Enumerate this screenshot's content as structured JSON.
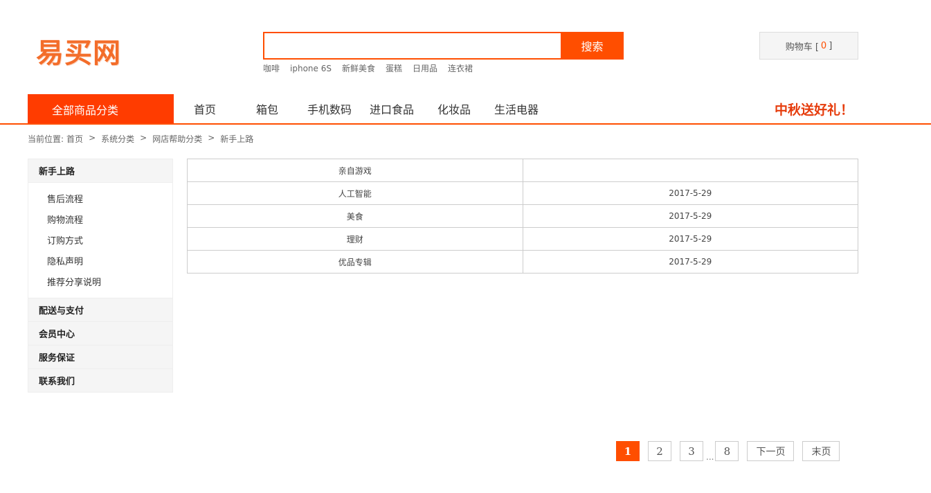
{
  "logo": {
    "text": "易买网"
  },
  "search": {
    "value": "",
    "placeholder": "",
    "button_label": "搜索"
  },
  "hot_words": [
    "咖啡",
    "iphone 6S",
    "新鲜美食",
    "蛋糕",
    "日用品",
    "连衣裙"
  ],
  "cart": {
    "label": "购物车 [",
    "count": "0",
    "suffix": "]"
  },
  "nav": {
    "all_categories": "全部商品分类",
    "items": [
      "首页",
      "箱包",
      "手机数码",
      "进口食品",
      "化妆品",
      "生活电器"
    ],
    "promo": "中秋送好礼！"
  },
  "breadcrumb": {
    "prefix": "当前位置:",
    "items": [
      "首页",
      "系统分类",
      "网店帮助分类",
      "新手上路"
    ],
    "separator": ">"
  },
  "sidebar": {
    "groups": [
      {
        "title": "新手上路",
        "items": [
          "售后流程",
          "购物流程",
          "订购方式",
          "隐私声明",
          "推荐分享说明"
        ]
      },
      {
        "title": "配送与支付"
      },
      {
        "title": "会员中心"
      },
      {
        "title": "服务保证"
      },
      {
        "title": "联系我们"
      }
    ]
  },
  "table": {
    "rows": [
      {
        "title": "亲自游戏",
        "date": ""
      },
      {
        "title": "人工智能",
        "date": "2017-5-29"
      },
      {
        "title": "美食",
        "date": "2017-5-29"
      },
      {
        "title": "理财",
        "date": "2017-5-29"
      },
      {
        "title": "优品专辑",
        "date": "2017-5-29"
      }
    ]
  },
  "pagination": {
    "pages": [
      "1",
      "2",
      "3"
    ],
    "dots": "...",
    "last_page": "8",
    "next_label": "下一页",
    "end_label": "末页",
    "current": "1"
  },
  "colors": {
    "accent": "#ff4e00",
    "promo": "#e63c0c",
    "logo": "#f36d2a"
  }
}
